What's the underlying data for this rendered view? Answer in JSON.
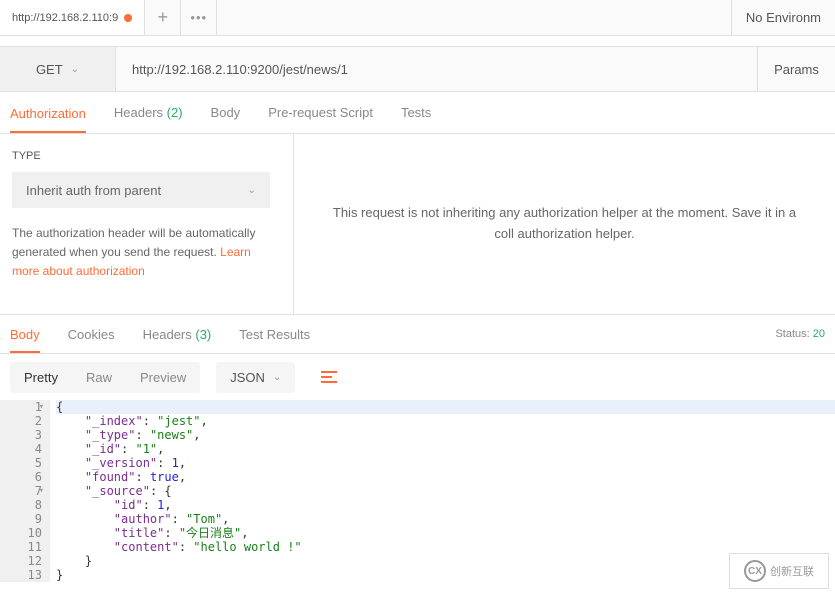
{
  "tabBar": {
    "tabTitle": "http://192.168.2.110:9",
    "envLabel": "No Environm"
  },
  "request": {
    "method": "GET",
    "url": "http://192.168.2.110:9200/jest/news/1",
    "paramsLabel": "Params"
  },
  "reqTabs": {
    "authorization": "Authorization",
    "headers": "Headers",
    "headersCount": "(2)",
    "body": "Body",
    "prerequest": "Pre-request Script",
    "tests": "Tests"
  },
  "auth": {
    "typeLabel": "TYPE",
    "selectValue": "Inherit auth from parent",
    "desc1": "The authorization header will be automatically generated when you send the request. ",
    "learnMore": "Learn more about authorization",
    "rightMsg": "This request is not inheriting any authorization helper at the moment. Save it in a coll authorization helper."
  },
  "respTabs": {
    "body": "Body",
    "cookies": "Cookies",
    "headers": "Headers",
    "headersCount": "(3)",
    "testResults": "Test Results",
    "statusLabel": "Status:",
    "statusValue": "20"
  },
  "bodyControls": {
    "pretty": "Pretty",
    "raw": "Raw",
    "preview": "Preview",
    "type": "JSON"
  },
  "response": {
    "lines": [
      {
        "n": "1",
        "fold": true,
        "code": [
          [
            "p",
            "{"
          ]
        ],
        "hl": true
      },
      {
        "n": "2",
        "code": [
          [
            "p",
            "    "
          ],
          [
            "k",
            "\"_index\""
          ],
          [
            "p",
            ": "
          ],
          [
            "s",
            "\"jest\""
          ],
          [
            "p",
            ","
          ]
        ]
      },
      {
        "n": "3",
        "code": [
          [
            "p",
            "    "
          ],
          [
            "k",
            "\"_type\""
          ],
          [
            "p",
            ": "
          ],
          [
            "s",
            "\"news\""
          ],
          [
            "p",
            ","
          ]
        ]
      },
      {
        "n": "4",
        "code": [
          [
            "p",
            "    "
          ],
          [
            "k",
            "\"_id\""
          ],
          [
            "p",
            ": "
          ],
          [
            "s",
            "\"1\""
          ],
          [
            "p",
            ","
          ]
        ]
      },
      {
        "n": "5",
        "code": [
          [
            "p",
            "    "
          ],
          [
            "k",
            "\"_version\""
          ],
          [
            "p",
            ": "
          ],
          [
            "n",
            "1"
          ],
          [
            "p",
            ","
          ]
        ]
      },
      {
        "n": "6",
        "code": [
          [
            "p",
            "    "
          ],
          [
            "k",
            "\"found\""
          ],
          [
            "p",
            ": "
          ],
          [
            "n",
            "true"
          ],
          [
            "p",
            ","
          ]
        ]
      },
      {
        "n": "7",
        "fold": true,
        "code": [
          [
            "p",
            "    "
          ],
          [
            "k",
            "\"_source\""
          ],
          [
            "p",
            ": {"
          ]
        ]
      },
      {
        "n": "8",
        "code": [
          [
            "p",
            "        "
          ],
          [
            "k",
            "\"id\""
          ],
          [
            "p",
            ": "
          ],
          [
            "n",
            "1"
          ],
          [
            "p",
            ","
          ]
        ]
      },
      {
        "n": "9",
        "code": [
          [
            "p",
            "        "
          ],
          [
            "k",
            "\"author\""
          ],
          [
            "p",
            ": "
          ],
          [
            "s",
            "\"Tom\""
          ],
          [
            "p",
            ","
          ]
        ]
      },
      {
        "n": "10",
        "code": [
          [
            "p",
            "        "
          ],
          [
            "k",
            "\"title\""
          ],
          [
            "p",
            ": "
          ],
          [
            "s",
            "\"今日消息\""
          ],
          [
            "p",
            ","
          ]
        ]
      },
      {
        "n": "11",
        "code": [
          [
            "p",
            "        "
          ],
          [
            "k",
            "\"content\""
          ],
          [
            "p",
            ": "
          ],
          [
            "s",
            "\"hello world !\""
          ]
        ]
      },
      {
        "n": "12",
        "code": [
          [
            "p",
            "    }"
          ]
        ]
      },
      {
        "n": "13",
        "code": [
          [
            "p",
            "}"
          ]
        ]
      }
    ]
  },
  "watermark": "创新互联"
}
